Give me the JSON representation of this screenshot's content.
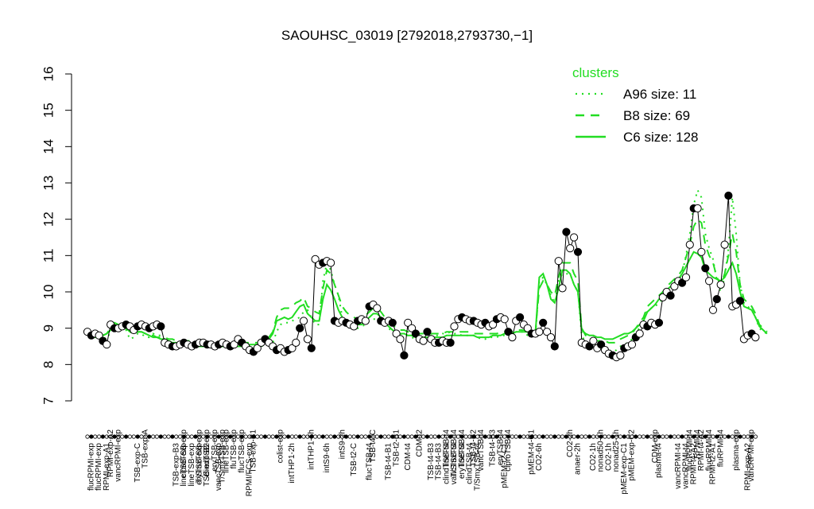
{
  "chart_data": {
    "type": "line",
    "title": "SAOUHSC_03019 [2792018,2793730,−1]",
    "ylim": [
      7,
      16
    ],
    "yticks": [
      "7",
      "8",
      "9",
      "10",
      "11",
      "12",
      "13",
      "14",
      "15",
      "16"
    ],
    "grid": false,
    "legend_placement": "top-right",
    "legend": {
      "title": "clusters",
      "items": [
        {
          "label": "A96 size: 11",
          "style": "dotted"
        },
        {
          "label": "B8 size: 69",
          "style": "dashed"
        },
        {
          "label": "C6 size: 128",
          "style": "solid"
        }
      ]
    },
    "colors": {
      "cluster": "#22dd22",
      "profile": "#000000"
    },
    "top_labels": [
      {
        "label": "RPMI-exp-A2",
        "x": 6
      },
      {
        "label": "vancRPMI-exp",
        "x": 8
      },
      {
        "label": "TSB-exp-A",
        "x": 15
      },
      {
        "label": "ciproTSB-exp",
        "x": 25
      },
      {
        "label": "T/SmxTSB-exp",
        "x": 29
      },
      {
        "label": "clindTSB-exp",
        "x": 31
      },
      {
        "label": "eryTSB-exp",
        "x": 33
      },
      {
        "label": "T/SmxTSB-exp",
        "x": 35
      },
      {
        "label": "lineTSB-exp",
        "x": 36
      },
      {
        "label": "fluTSB-exp",
        "x": 38
      },
      {
        "label": "flucTSB-exp",
        "x": 40
      },
      {
        "label": "TSB-exp-B1",
        "x": 43
      },
      {
        "label": "colist-exp",
        "x": 50
      },
      {
        "label": "intTHP1-6h",
        "x": 58
      },
      {
        "label": "intS9-2h",
        "x": 66
      },
      {
        "label": "TSB-t4-C",
        "x": 74
      },
      {
        "label": "TSB-t2-B1",
        "x": 80
      },
      {
        "label": "CDM-t2",
        "x": 86
      },
      {
        "label": "lineTSB-t4",
        "x": 93
      },
      {
        "label": "T/SmxTSB-t4",
        "x": 95
      },
      {
        "label": "lineTSB-t4",
        "x": 97
      },
      {
        "label": "TSB-t4-B2",
        "x": 100
      },
      {
        "label": "vancTSB-t4",
        "x": 102
      },
      {
        "label": "TSB-t4-B3",
        "x": 105
      },
      {
        "label": "eryTSB-t4",
        "x": 107
      },
      {
        "label": "ciproTSB-t4",
        "x": 109
      },
      {
        "label": "pMEM-t4-C1",
        "x": 115
      },
      {
        "label": "CO2-2h",
        "x": 125
      },
      {
        "label": "nonad50-1h",
        "x": 133
      },
      {
        "label": "nonad25-1h",
        "x": 137
      },
      {
        "label": "pMEM-exp-C2",
        "x": 141
      },
      {
        "label": "CDM-exp",
        "x": 147
      },
      {
        "label": "flucRPMI-t4",
        "x": 156
      },
      {
        "label": "RPMI-t4",
        "x": 158
      },
      {
        "label": "RPMI-t4-A2",
        "x": 159
      },
      {
        "label": "flucRPMI-t4",
        "x": 161
      },
      {
        "label": "fluRPMI-t4",
        "x": 164
      },
      {
        "label": "plasma-exp",
        "x": 168
      },
      {
        "label": "vancRPMI-exp",
        "x": 172
      }
    ],
    "bottom_labels": [
      {
        "label": "flucRPMI-exp",
        "x": 1
      },
      {
        "label": "flucRPMI-exp",
        "x": 3
      },
      {
        "label": "RPMI-exp-A1",
        "x": 5
      },
      {
        "label": "TSB-exp-C",
        "x": 13
      },
      {
        "label": "TSB-exp-B3",
        "x": 23
      },
      {
        "label": "lineTSB-exp",
        "x": 25
      },
      {
        "label": "lineTSB-exp",
        "x": 27
      },
      {
        "label": "eryTSB-exp",
        "x": 29
      },
      {
        "label": "TSB-exp-B2",
        "x": 31
      },
      {
        "label": "vancTSB-exp",
        "x": 34
      },
      {
        "label": "RPMI/FCS-exp",
        "x": 42
      },
      {
        "label": "intTHP1-2h",
        "x": 53
      },
      {
        "label": "intS9-6h",
        "x": 62
      },
      {
        "label": "TSB-t2-C",
        "x": 69
      },
      {
        "label": "flucTSB-t4",
        "x": 73
      },
      {
        "label": "TSB-t4-B1",
        "x": 78
      },
      {
        "label": "CDM-t4",
        "x": 83
      },
      {
        "label": "TSB-t4-B3",
        "x": 89
      },
      {
        "label": "TSB-t4-B3",
        "x": 91
      },
      {
        "label": "clindTSB-t4",
        "x": 93
      },
      {
        "label": "vancTSB-t4",
        "x": 95
      },
      {
        "label": "eryTSB-t4",
        "x": 97
      },
      {
        "label": "clindTSB-t4",
        "x": 99
      },
      {
        "label": "T/SmxTSB-t4",
        "x": 101
      },
      {
        "label": "pMEM-t2-C1",
        "x": 108
      },
      {
        "label": "CO2-6h",
        "x": 117
      },
      {
        "label": "anaer-2h",
        "x": 127
      },
      {
        "label": "CO2-1h",
        "x": 131
      },
      {
        "label": "CO2-1h",
        "x": 135
      },
      {
        "label": "pMEM-exp-C1",
        "x": 139
      },
      {
        "label": "plasma-t4",
        "x": 148
      },
      {
        "label": "vancRPMI-t4",
        "x": 153
      },
      {
        "label": "vancRPMI-t4",
        "x": 155
      },
      {
        "label": "RPMI-t4-A2",
        "x": 157
      },
      {
        "label": "RPMI-t2-A1",
        "x": 162
      },
      {
        "label": "RPMI-exp-A2",
        "x": 171
      }
    ],
    "series": [
      {
        "name": "A96 size: 11",
        "style": "dotted",
        "values": [
          8.9,
          8.8,
          8.8,
          8.75,
          8.75,
          8.7,
          8.9,
          9.1,
          9.0,
          8.95,
          8.95,
          8.7,
          8.75,
          8.85,
          8.85,
          8.75,
          8.75,
          8.85,
          8.8,
          8.8,
          8.7,
          8.65,
          8.6,
          8.55,
          8.55,
          8.55,
          8.6,
          8.55,
          8.55,
          8.6,
          8.55,
          8.5,
          8.5,
          8.5,
          8.5,
          8.55,
          8.55,
          8.5,
          8.5,
          8.5,
          8.5,
          8.5,
          8.5,
          8.5,
          8.5,
          8.5,
          8.55,
          8.55,
          8.6,
          8.9,
          9.1,
          9.15,
          9.15,
          9.2,
          9.25,
          9.3,
          9.45,
          9.5,
          9.3,
          9.1,
          9.1,
          10.3,
          10.8,
          10.6,
          10.2,
          9.9,
          9.3,
          9.2,
          9.1,
          9.0,
          9.0,
          9.05,
          9.1,
          9.2,
          9.25,
          9.25,
          9.2,
          9.1,
          9.0,
          8.9,
          8.85,
          8.85,
          8.8,
          8.8,
          8.75,
          8.7,
          8.7,
          8.7,
          8.75,
          8.8,
          8.8,
          8.8,
          8.85,
          8.85,
          8.9,
          8.85,
          8.85,
          8.8,
          8.8,
          8.8,
          8.8,
          8.75,
          8.7,
          8.7,
          8.75,
          8.75,
          8.75,
          8.8,
          8.8,
          8.85,
          8.85,
          8.9,
          8.9,
          8.9,
          8.8,
          8.8,
          8.75,
          10.3,
          10.4,
          10.2,
          9.9,
          9.7,
          10.3,
          10.5,
          10.5,
          10.5,
          10.2,
          10.0,
          8.8,
          8.6,
          8.6,
          8.5,
          8.5,
          8.5,
          8.45,
          8.4,
          8.35,
          8.4,
          8.5,
          8.55,
          8.6,
          8.7,
          8.9,
          9.0,
          9.2,
          9.5,
          9.55,
          9.6,
          9.7,
          9.8,
          10.0,
          10.1,
          10.2,
          10.3,
          10.5,
          11.0,
          11.6,
          12.4,
          12.8,
          12.6,
          11.6,
          11.2,
          10.9,
          10.3,
          10.0,
          10.4,
          11.2,
          12.6,
          11.6,
          10.2,
          9.7,
          9.6,
          9.5,
          9.3,
          9.0,
          8.9,
          8.85
        ]
      },
      {
        "name": "B8 size: 69",
        "style": "dashed",
        "values": [
          8.9,
          8.85,
          8.8,
          8.8,
          8.8,
          8.85,
          9.0,
          9.15,
          9.1,
          9.05,
          9.0,
          8.9,
          8.85,
          8.9,
          8.9,
          8.85,
          8.8,
          8.8,
          8.75,
          8.75,
          8.75,
          8.7,
          8.7,
          8.65,
          8.65,
          8.65,
          8.65,
          8.65,
          8.6,
          8.6,
          8.6,
          8.6,
          8.6,
          8.55,
          8.55,
          8.55,
          8.55,
          8.55,
          8.6,
          8.6,
          8.6,
          8.6,
          8.6,
          8.6,
          8.6,
          8.65,
          8.7,
          8.75,
          8.9,
          9.3,
          9.5,
          9.55,
          9.55,
          9.6,
          9.7,
          9.75,
          9.85,
          9.6,
          9.55,
          9.45,
          9.4,
          10.1,
          10.6,
          10.5,
          10.2,
          9.9,
          9.6,
          9.45,
          9.35,
          9.3,
          9.25,
          9.25,
          9.35,
          9.45,
          9.55,
          9.55,
          9.45,
          9.3,
          9.2,
          9.1,
          9.0,
          8.95,
          8.95,
          8.9,
          8.9,
          8.85,
          8.85,
          8.85,
          8.85,
          8.85,
          8.85,
          8.85,
          8.85,
          8.9,
          8.9,
          8.9,
          8.9,
          8.9,
          8.9,
          8.9,
          8.85,
          8.85,
          8.85,
          8.85,
          8.85,
          8.85,
          8.85,
          8.9,
          8.9,
          8.9,
          8.9,
          8.95,
          8.95,
          8.95,
          8.9,
          8.9,
          8.9,
          10.1,
          10.3,
          10.2,
          10.0,
          9.9,
          10.4,
          10.8,
          10.8,
          10.8,
          10.5,
          10.3,
          9.0,
          8.8,
          8.75,
          8.7,
          8.65,
          8.65,
          8.65,
          8.6,
          8.6,
          8.6,
          8.7,
          8.75,
          8.8,
          8.85,
          9.0,
          9.15,
          9.3,
          9.6,
          9.7,
          9.8,
          9.9,
          10.0,
          10.15,
          10.25,
          10.35,
          10.45,
          10.6,
          10.95,
          11.3,
          11.8,
          12.0,
          11.9,
          11.3,
          11.0,
          10.8,
          10.4,
          10.2,
          10.5,
          11.0,
          11.6,
          11.1,
          10.2,
          9.8,
          9.7,
          9.6,
          9.4,
          9.1,
          9.0,
          8.9
        ]
      },
      {
        "name": "C6 size: 128",
        "style": "solid",
        "values": [
          8.85,
          8.8,
          8.75,
          8.75,
          8.8,
          8.85,
          8.95,
          9.05,
          9.05,
          9.0,
          9.0,
          8.95,
          8.9,
          8.9,
          8.9,
          8.85,
          8.8,
          8.75,
          8.75,
          8.7,
          8.7,
          8.65,
          8.6,
          8.6,
          8.55,
          8.55,
          8.55,
          8.55,
          8.5,
          8.5,
          8.5,
          8.5,
          8.5,
          8.5,
          8.5,
          8.5,
          8.5,
          8.5,
          8.5,
          8.5,
          8.5,
          8.5,
          8.55,
          8.55,
          8.55,
          8.6,
          8.65,
          8.7,
          8.85,
          9.2,
          9.25,
          9.3,
          9.25,
          9.3,
          9.45,
          9.6,
          9.65,
          9.4,
          9.3,
          9.2,
          9.2,
          9.8,
          10.2,
          10.05,
          9.8,
          9.5,
          9.3,
          9.2,
          9.15,
          9.1,
          9.1,
          9.1,
          9.2,
          9.3,
          9.4,
          9.4,
          9.3,
          9.15,
          9.05,
          8.95,
          8.9,
          8.85,
          8.85,
          8.8,
          8.8,
          8.75,
          8.75,
          8.75,
          8.75,
          8.75,
          8.75,
          8.75,
          8.75,
          8.8,
          8.8,
          8.8,
          8.8,
          8.8,
          8.8,
          8.8,
          8.8,
          8.75,
          8.75,
          8.75,
          8.75,
          8.8,
          8.8,
          8.8,
          8.85,
          8.85,
          8.85,
          8.9,
          8.9,
          8.9,
          8.9,
          8.85,
          8.85,
          10.4,
          10.5,
          10.2,
          9.8,
          9.7,
          10.1,
          10.6,
          10.6,
          10.5,
          10.2,
          10.0,
          8.95,
          8.85,
          8.8,
          8.8,
          8.75,
          8.75,
          8.7,
          8.7,
          8.7,
          8.75,
          8.8,
          8.85,
          8.85,
          8.9,
          9.0,
          9.1,
          9.2,
          9.45,
          9.55,
          9.65,
          9.8,
          9.9,
          10.05,
          10.15,
          10.25,
          10.35,
          10.5,
          10.7,
          10.9,
          11.1,
          11.05,
          10.95,
          10.6,
          10.5,
          10.4,
          10.35,
          10.3,
          10.4,
          10.6,
          10.8,
          10.5,
          10.0,
          9.6,
          9.55,
          9.5,
          9.3,
          9.05,
          8.95,
          8.85
        ]
      },
      {
        "name": "",
        "style": "profile",
        "values": [
          8.9,
          8.8,
          8.85,
          8.8,
          8.65,
          8.55,
          9.1,
          9.0,
          9.0,
          9.05,
          9.1,
          9.05,
          8.95,
          9.05,
          9.1,
          9.05,
          9.0,
          9.05,
          9.1,
          9.05,
          8.6,
          8.55,
          8.5,
          8.5,
          8.55,
          8.6,
          8.55,
          8.5,
          8.55,
          8.6,
          8.6,
          8.55,
          8.55,
          8.5,
          8.55,
          8.6,
          8.55,
          8.5,
          8.55,
          8.7,
          8.6,
          8.5,
          8.4,
          8.35,
          8.45,
          8.6,
          8.7,
          8.6,
          8.5,
          8.4,
          8.45,
          8.35,
          8.4,
          8.45,
          8.6,
          9.0,
          9.2,
          8.7,
          8.45,
          10.9,
          10.75,
          10.8,
          10.85,
          10.8,
          9.2,
          9.15,
          9.2,
          9.15,
          9.1,
          9.05,
          9.2,
          9.25,
          9.2,
          9.6,
          9.65,
          9.55,
          9.2,
          9.15,
          9.2,
          9.15,
          8.85,
          8.7,
          8.25,
          9.15,
          9.0,
          8.85,
          8.7,
          8.65,
          8.9,
          8.7,
          8.6,
          8.6,
          8.65,
          8.6,
          8.6,
          9.05,
          9.25,
          9.3,
          9.25,
          9.2,
          9.2,
          9.15,
          9.1,
          9.15,
          9.05,
          9.1,
          9.25,
          9.3,
          9.25,
          8.9,
          8.75,
          9.2,
          9.3,
          9.1,
          9.0,
          8.85,
          8.85,
          8.9,
          9.15,
          8.9,
          8.75,
          8.5,
          10.85,
          10.1,
          11.65,
          11.2,
          11.5,
          11.1,
          8.6,
          8.55,
          8.5,
          8.65,
          8.45,
          8.55,
          8.4,
          8.3,
          8.25,
          8.2,
          8.25,
          8.45,
          8.5,
          8.55,
          8.75,
          8.85,
          9.1,
          9.05,
          9.15,
          9.1,
          9.15,
          9.85,
          10.0,
          9.9,
          10.15,
          10.3,
          10.25,
          10.4,
          11.3,
          12.3,
          12.3,
          11.1,
          10.65,
          10.3,
          9.5,
          9.8,
          10.2,
          11.3,
          12.65,
          9.6,
          9.65,
          9.75,
          8.7,
          8.8,
          8.85,
          8.75
        ]
      }
    ]
  }
}
